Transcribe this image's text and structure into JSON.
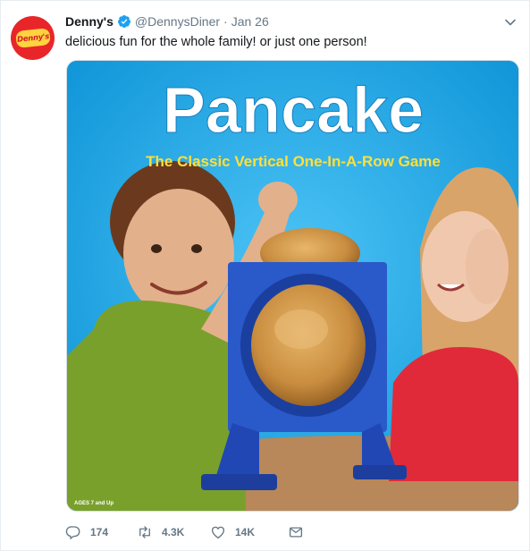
{
  "tweet": {
    "avatar_text": "Denny's",
    "name": "Denny's",
    "handle": "@DennysDiner",
    "separator": "·",
    "date": "Jan 26",
    "text": "delicious fun for the whole family! or just one person!"
  },
  "media": {
    "title": "Pancake",
    "subtitle": "The Classic Vertical One-In-A-Row Game",
    "age_note": "AGES 7 and Up"
  },
  "actions": {
    "replies": "174",
    "retweets": "4.3K",
    "likes": "14K"
  },
  "icons": {
    "verified": "verified-badge-icon",
    "caret": "chevron-down-icon",
    "reply": "reply-icon",
    "retweet": "retweet-icon",
    "like": "heart-icon",
    "dm": "envelope-icon"
  },
  "colors": {
    "brand_red": "#e8262a",
    "brand_yellow": "#ffd23f",
    "verified_blue": "#1da1f2",
    "muted": "#657786",
    "text": "#14171a"
  }
}
